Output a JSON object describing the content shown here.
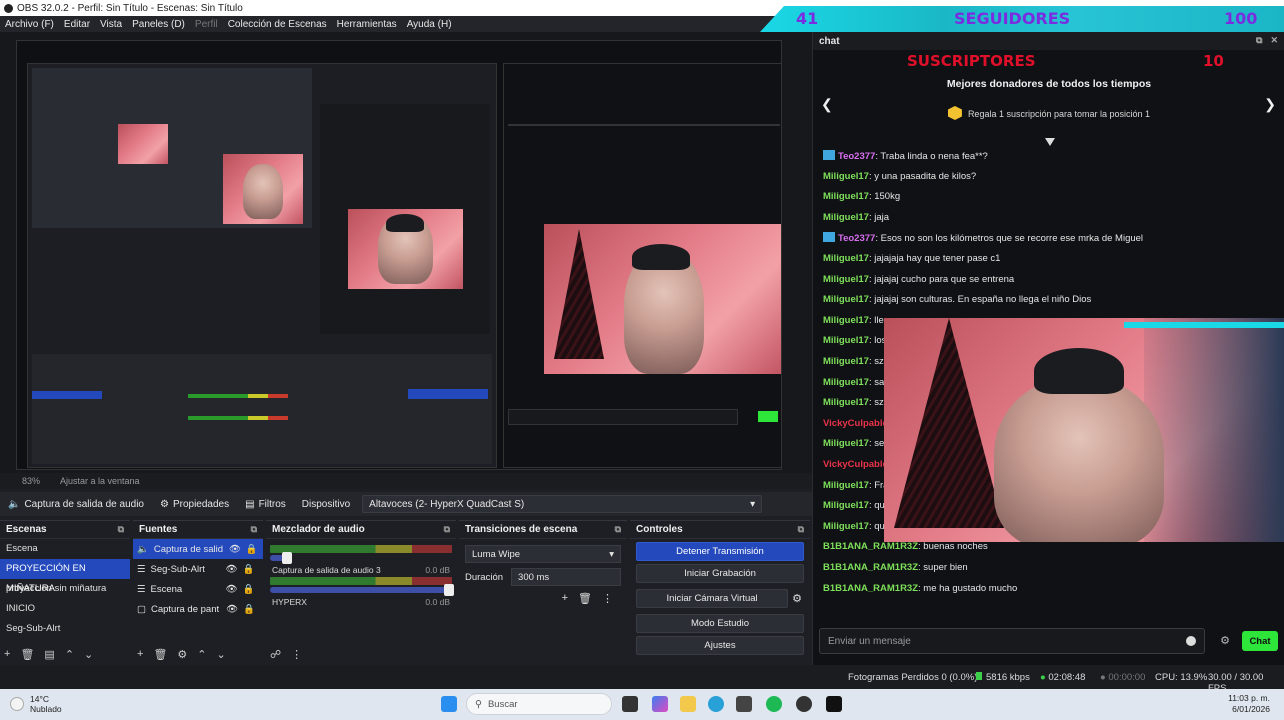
{
  "window": {
    "title": "OBS 32.0.2 - Perfil: Sin Título - Escenas: Sin Título"
  },
  "menu": [
    "Archivo (F)",
    "Editar",
    "Vista",
    "Paneles (D)",
    "Perfil",
    "Colección de Escenas",
    "Herramientas",
    "Ayuda (H)"
  ],
  "overlay": {
    "followers_count": "41",
    "followers_label": "SEGUIDORES",
    "followers_goal": "100",
    "subscribers_label": "SUSCRIPTORES",
    "subscribers_count": "10"
  },
  "preview": {
    "zoom": "83%",
    "zoom_label": "Ajustar a la ventana"
  },
  "source_toolbar": {
    "source_name": "Captura de salida de audio",
    "properties": "Propiedades",
    "filters": "Filtros",
    "device_label": "Dispositivo",
    "device_value": "Altavoces (2- HyperX QuadCast S)"
  },
  "scenes": {
    "title": "Escenas",
    "items": [
      "Escena",
      "PROYECCIÓN EN MIÑATURA",
      "proyeccion sin miñatura",
      "INICIO",
      "Seg-Sub-Alrt"
    ],
    "selected_index": 1
  },
  "sources": {
    "title": "Fuentes",
    "items": [
      "Captura de salid",
      "Seg-Sub-Alrt",
      "Escena",
      "Captura de pant"
    ]
  },
  "mixer": {
    "title": "Mezclador de audio",
    "channels": [
      {
        "name": "",
        "db": ""
      },
      {
        "name": "Captura de salida de audio 3",
        "db": "0.0 dB"
      },
      {
        "name": "HYPERX",
        "db": "0.0 dB"
      }
    ]
  },
  "transitions": {
    "title": "Transiciones de escena",
    "selected": "Luma Wipe",
    "duration_label": "Duración",
    "duration_value": "300 ms"
  },
  "controls": {
    "title": "Controles",
    "buttons": [
      "Detener Transmisión",
      "Iniciar Grabación",
      "Iniciar Cámara Virtual",
      "Modo Estudio",
      "Ajustes"
    ]
  },
  "status": {
    "dropped_frames": "Fotogramas Perdidos 0 (0.0%)",
    "bitrate": "5816 kbps",
    "stream_time": "02:08:48",
    "rec_time": "00:00:00",
    "cpu": "CPU: 13.9%",
    "fps": "30.00 / 30.00 FPS"
  },
  "chat": {
    "panel_title": "chat",
    "top_donors_title": "Mejores donadores de todos los tiempos",
    "top_donors_prompt": "Regala 1 suscripción para tomar la posición 1",
    "messages": [
      {
        "user": "Teo2377",
        "text": ": Traba linda o nena fea**?",
        "color": "p",
        "badge": true
      },
      {
        "user": "Miliguel17",
        "text": ": y una pasadita de kilos?",
        "color": "g",
        "badge": false
      },
      {
        "user": "Miliguel17",
        "text": ": 150kg",
        "color": "g",
        "badge": false
      },
      {
        "user": "Miliguel17",
        "text": ": jaja",
        "color": "g",
        "badge": false
      },
      {
        "user": "Teo2377",
        "text": ": Esos no son los kilómetros que se recorre ese mrka de Miguel",
        "color": "p",
        "badge": true
      },
      {
        "user": "Miliguel17",
        "text": ": jajajaja hay que tener pase c1",
        "color": "g",
        "badge": false
      },
      {
        "user": "Miliguel17",
        "text": ": jajajaj cucho para que se entrena",
        "color": "g",
        "badge": false
      },
      {
        "user": "Miliguel17",
        "text": ": jajajaj son culturas. En españa no llega el niño Dios",
        "color": "g",
        "badge": false
      },
      {
        "user": "Miliguel17",
        "text": ": lleg",
        "color": "g",
        "badge": false
      },
      {
        "user": "Miliguel17",
        "text": ": los",
        "color": "g",
        "badge": false
      },
      {
        "user": "Miliguel17",
        "text": ": sza",
        "color": "g",
        "badge": false
      },
      {
        "user": "Miliguel17",
        "text": ": san",
        "color": "g",
        "badge": false
      },
      {
        "user": "Miliguel17",
        "text": ": sza",
        "color": "g",
        "badge": false
      },
      {
        "user": "VickyCulpable",
        "text": "",
        "color": "r",
        "badge": false
      },
      {
        "user": "Miliguel17",
        "text": ": se",
        "color": "g",
        "badge": false
      },
      {
        "user": "VickyCulpable",
        "text": "",
        "color": "r",
        "badge": false
      },
      {
        "user": "Miliguel17",
        "text": ": Fra",
        "color": "g",
        "badge": false
      },
      {
        "user": "Miliguel17",
        "text": ": que",
        "color": "g",
        "badge": false
      },
      {
        "user": "Miliguel17",
        "text": ": quejoso?",
        "color": "g",
        "badge": false
      },
      {
        "user": "B1B1ANA_RAM1R3Z",
        "text": ": buenas noches",
        "color": "g",
        "badge": false
      },
      {
        "user": "B1B1ANA_RAM1R3Z",
        "text": ": super bien",
        "color": "g",
        "badge": false
      },
      {
        "user": "B1B1ANA_RAM1R3Z",
        "text": ": me ha gustado mucho",
        "color": "g",
        "badge": false
      }
    ],
    "input_placeholder": "Enviar un mensaje",
    "send_label": "Chat"
  },
  "taskbar": {
    "temp": "14°C",
    "weather": "Nublado",
    "search_placeholder": "Buscar",
    "time": "11:03 p. m.",
    "date": "6/01/2026"
  }
}
